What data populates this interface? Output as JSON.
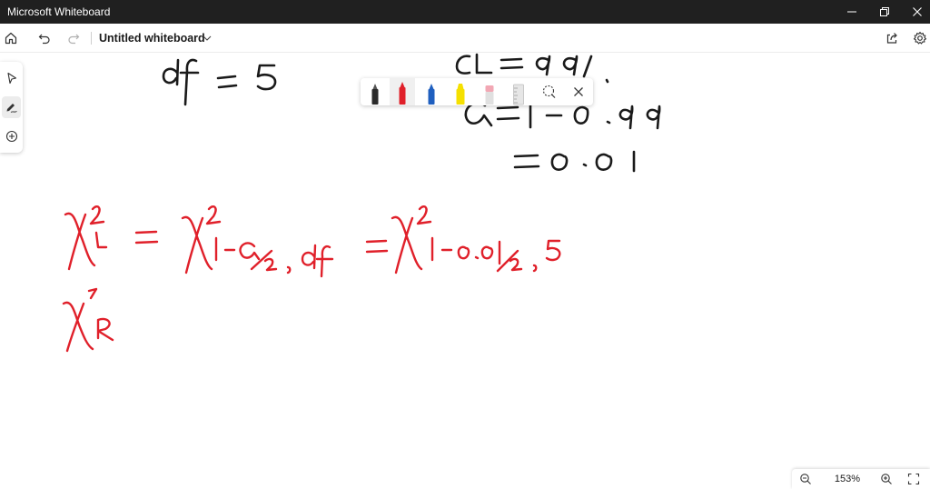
{
  "window": {
    "app_title": "Microsoft Whiteboard",
    "controls": [
      "minimize-icon",
      "restore-icon",
      "close-icon"
    ]
  },
  "commandbar": {
    "board_title": "Untitled whiteboard",
    "icons": [
      "home-icon",
      "undo-icon",
      "redo-icon",
      "chevron-down-icon",
      "share-icon",
      "gear-icon"
    ]
  },
  "left_toolbar": {
    "items": [
      {
        "icon": "select-arrow-icon",
        "active": false
      },
      {
        "icon": "pen-ink-icon",
        "active": true
      },
      {
        "icon": "add-circle-icon",
        "active": false
      }
    ]
  },
  "pen_toolbar": {
    "pens": [
      {
        "icon": "pen-icon",
        "color": "#1a1a1a",
        "selected": false
      },
      {
        "icon": "pen-icon",
        "color": "#e0202a",
        "selected": true
      },
      {
        "icon": "pen-icon",
        "color": "#1f5fbf",
        "selected": false
      },
      {
        "icon": "highlighter-icon",
        "color": "#f5e000",
        "selected": false
      },
      {
        "icon": "eraser-icon",
        "color": "#f2a7b4",
        "selected": false
      },
      {
        "icon": "ruler-icon",
        "color": "#d0d0d0",
        "selected": false
      }
    ],
    "extra_icons": [
      "lasso-icon",
      "close-icon"
    ]
  },
  "canvas": {
    "ink_colors": {
      "black": "#1a1a1a",
      "red": "#e0202a"
    },
    "ink_strokes": [
      {
        "name": "handwritten-df-equals-5",
        "color": "black"
      },
      {
        "name": "handwritten-cl-equals-99-percent",
        "color": "black"
      },
      {
        "name": "handwritten-alpha-equals-1-minus-0-99",
        "color": "black"
      },
      {
        "name": "handwritten-equals-0-01",
        "color": "black"
      },
      {
        "name": "handwritten-chi-square-left-formula",
        "color": "red"
      },
      {
        "name": "handwritten-chi-square-right",
        "color": "red"
      }
    ]
  },
  "zoom": {
    "level": "153%",
    "icons": [
      "zoom-out-icon",
      "zoom-in-icon",
      "fit-screen-icon"
    ]
  },
  "colors": {
    "titlebar_bg": "#202020",
    "accent_red": "#e0202a"
  }
}
